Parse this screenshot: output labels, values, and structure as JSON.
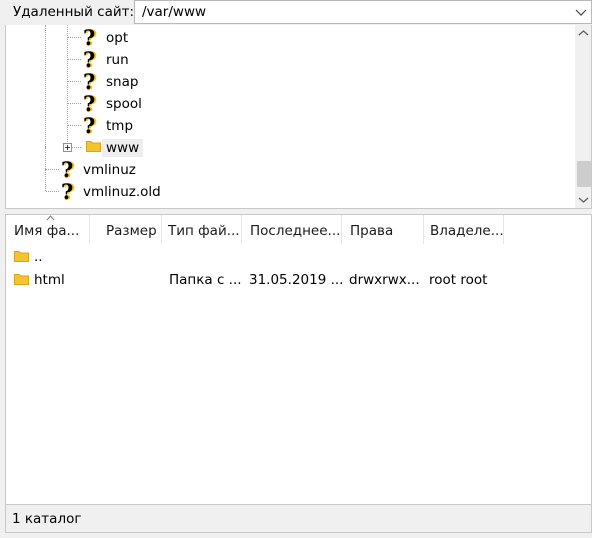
{
  "path_bar": {
    "label": "Удаленный сайт:",
    "value": "/var/www",
    "dropdown_icon": "chevron-down-icon"
  },
  "tree": {
    "items": [
      {
        "label": "opt",
        "icon": "question-icon"
      },
      {
        "label": "run",
        "icon": "question-icon"
      },
      {
        "label": "snap",
        "icon": "question-icon"
      },
      {
        "label": "spool",
        "icon": "question-icon"
      },
      {
        "label": "tmp",
        "icon": "question-icon"
      },
      {
        "label": "www",
        "icon": "folder-icon",
        "selected": true,
        "expandable": true
      },
      {
        "label": "vmlinuz",
        "icon": "question-icon"
      },
      {
        "label": "vmlinuz.old",
        "icon": "question-icon"
      }
    ]
  },
  "list": {
    "columns": [
      "Имя фа...",
      "Размер",
      "Тип фай...",
      "Последнее...",
      "Права",
      "Владеле..."
    ],
    "sort_column": "Имя фа...",
    "rows": [
      {
        "name": "..",
        "size": "",
        "type": "",
        "modified": "",
        "perms": "",
        "owner": "",
        "icon": "folder-icon"
      },
      {
        "name": "html",
        "size": "",
        "type": "Папка с ...",
        "modified": "31.05.2019 ...",
        "perms": "drwxrwx...",
        "owner": "root root",
        "icon": "folder-icon"
      }
    ]
  },
  "status": {
    "text": "1 каталог"
  },
  "colors": {
    "folder": "#f4c430",
    "background": "#f0f0f0",
    "panel": "#ffffff"
  }
}
